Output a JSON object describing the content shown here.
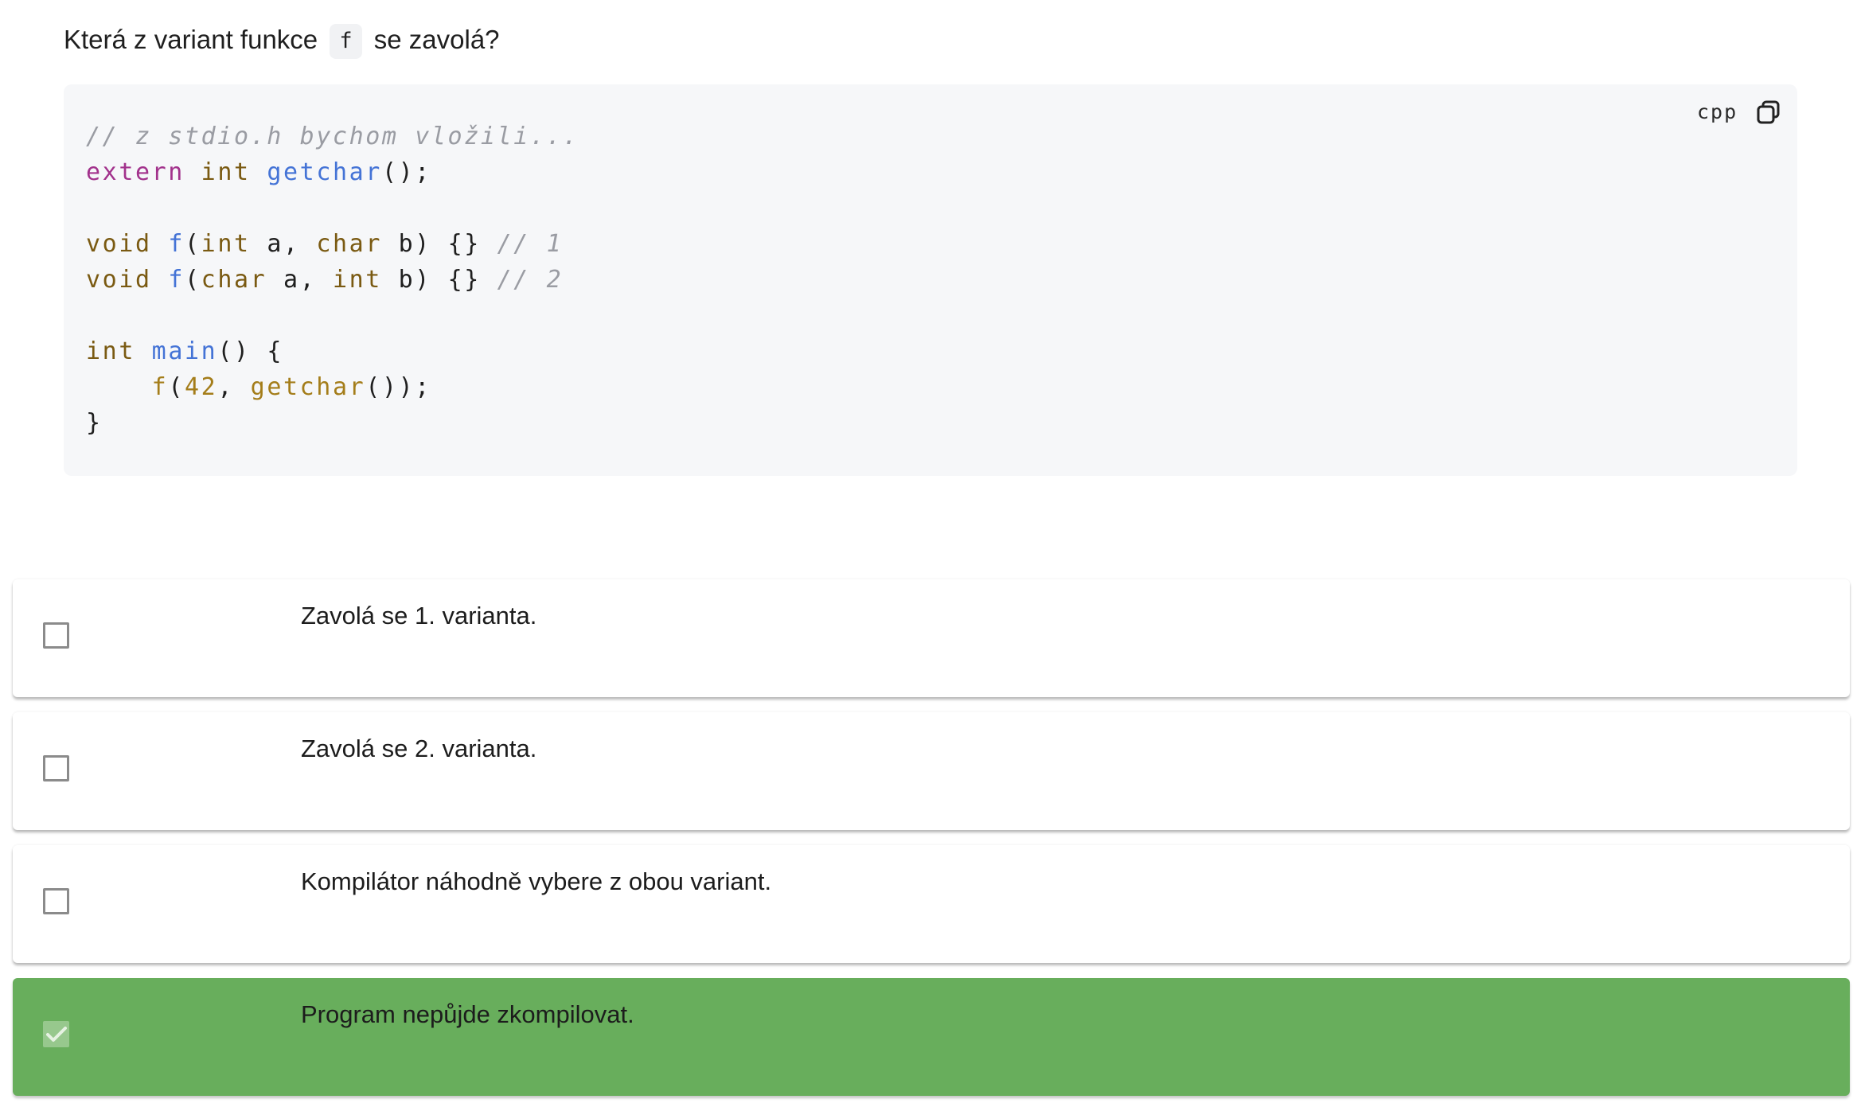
{
  "question": {
    "prefix": "Která z variant funkce",
    "code": "f",
    "suffix": "se zavolá?"
  },
  "code_block": {
    "language": "cpp",
    "copy_icon": "copy-icon",
    "lines": [
      [
        {
          "cls": "tok-comment",
          "text": "// z stdio.h bychom vložili..."
        }
      ],
      [
        {
          "cls": "tok-keyword",
          "text": "extern"
        },
        {
          "cls": "tok-plain",
          "text": " "
        },
        {
          "cls": "tok-type",
          "text": "int"
        },
        {
          "cls": "tok-plain",
          "text": " "
        },
        {
          "cls": "tok-func",
          "text": "getchar"
        },
        {
          "cls": "tok-plain",
          "text": "();"
        }
      ],
      [],
      [
        {
          "cls": "tok-type",
          "text": "void"
        },
        {
          "cls": "tok-plain",
          "text": " "
        },
        {
          "cls": "tok-func",
          "text": "f"
        },
        {
          "cls": "tok-plain",
          "text": "("
        },
        {
          "cls": "tok-type",
          "text": "int"
        },
        {
          "cls": "tok-plain",
          "text": " a, "
        },
        {
          "cls": "tok-type",
          "text": "char"
        },
        {
          "cls": "tok-plain",
          "text": " b) {} "
        },
        {
          "cls": "tok-comment",
          "text": "// 1"
        }
      ],
      [
        {
          "cls": "tok-type",
          "text": "void"
        },
        {
          "cls": "tok-plain",
          "text": " "
        },
        {
          "cls": "tok-func",
          "text": "f"
        },
        {
          "cls": "tok-plain",
          "text": "("
        },
        {
          "cls": "tok-type",
          "text": "char"
        },
        {
          "cls": "tok-plain",
          "text": " a, "
        },
        {
          "cls": "tok-type",
          "text": "int"
        },
        {
          "cls": "tok-plain",
          "text": " b) {} "
        },
        {
          "cls": "tok-comment",
          "text": "// 2"
        }
      ],
      [],
      [
        {
          "cls": "tok-type",
          "text": "int"
        },
        {
          "cls": "tok-plain",
          "text": " "
        },
        {
          "cls": "tok-func",
          "text": "main"
        },
        {
          "cls": "tok-plain",
          "text": "() {"
        }
      ],
      [
        {
          "cls": "tok-plain",
          "text": "    "
        },
        {
          "cls": "tok-call",
          "text": "f"
        },
        {
          "cls": "tok-plain",
          "text": "("
        },
        {
          "cls": "tok-call",
          "text": "42"
        },
        {
          "cls": "tok-plain",
          "text": ", "
        },
        {
          "cls": "tok-call",
          "text": "getchar"
        },
        {
          "cls": "tok-plain",
          "text": "());"
        }
      ],
      [
        {
          "cls": "tok-plain",
          "text": "}"
        }
      ]
    ]
  },
  "options": [
    {
      "label": "Zavolá se 1. varianta.",
      "checked": false
    },
    {
      "label": "Zavolá se 2. varianta.",
      "checked": false
    },
    {
      "label": "Kompilátor náhodně vybere z obou variant.",
      "checked": false
    },
    {
      "label": "Program nepůjde zkompilovat.",
      "checked": true
    }
  ],
  "colors": {
    "selected_option_bg": "#68ae5c",
    "selected_checkbox": "#97c88d",
    "code_bg": "#f6f7f9"
  }
}
